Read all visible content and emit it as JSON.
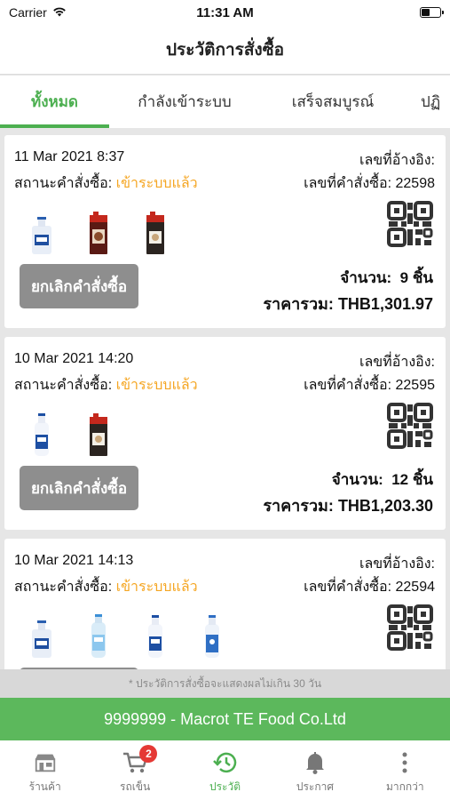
{
  "status_bar": {
    "carrier": "Carrier",
    "time": "11:31 AM"
  },
  "header": {
    "title": "ประวัติการสั่งซื้อ"
  },
  "tabs": [
    {
      "label": "ทั้งหมด",
      "active": true
    },
    {
      "label": "กำลังเข้าระบบ",
      "active": false
    },
    {
      "label": "เสร็จสมบูรณ์",
      "active": false
    },
    {
      "label": "ปฏิ",
      "active": false
    }
  ],
  "labels": {
    "status_prefix": "สถานะคำสั่งซื้อ:",
    "ref_prefix": "เลขที่อ้างอิง:",
    "order_no_prefix": "เลขที่คำสั่งซื้อ:",
    "qty_prefix": "จำนวน:",
    "total_prefix": "ราคารวม:",
    "cancel_button": "ยกเลิกคำสั่งซื้อ"
  },
  "orders": [
    {
      "date": "11 Mar 2021 8:37",
      "status": "เข้าระบบแล้ว",
      "ref": "",
      "order_no": "22598",
      "qty": "9 ชิ้น",
      "total": "THB1,301.97",
      "products": [
        "jug-bottle",
        "red-carton",
        "dark-carton"
      ]
    },
    {
      "date": "10 Mar 2021 14:20",
      "status": "เข้าระบบแล้ว",
      "ref": "",
      "order_no": "22595",
      "qty": "12 ชิ้น",
      "total": "THB1,203.30",
      "products": [
        "white-bottle",
        "dark-carton"
      ]
    },
    {
      "date": "10 Mar 2021 14:13",
      "status": "เข้าระบบแล้ว",
      "ref": "",
      "order_no": "22594",
      "qty": "",
      "total": "",
      "products": [
        "jug-bottle",
        "light-blue-bottle",
        "white-bottle",
        "white-bottle-blue"
      ]
    }
  ],
  "notice": "* ประวัติการสั่งซื้อจะแสดงผลไม่เกิน 30 วัน",
  "company": "9999999 - Macrot TE Food Co.Ltd",
  "bottom_nav": [
    {
      "label": "ร้านค้า",
      "icon": "store-icon",
      "active": false
    },
    {
      "label": "รถเข็น",
      "icon": "cart-icon",
      "active": false,
      "badge": "2"
    },
    {
      "label": "ประวัติ",
      "icon": "history-icon",
      "active": true
    },
    {
      "label": "ประกาศ",
      "icon": "bell-icon",
      "active": false
    },
    {
      "label": "มากกว่า",
      "icon": "more-icon",
      "active": false
    }
  ],
  "colors": {
    "accent": "#4caf50",
    "status": "#f5a623",
    "company_bar": "#5cb85c",
    "badge": "#e53935",
    "cancel": "#8e8e8e"
  }
}
